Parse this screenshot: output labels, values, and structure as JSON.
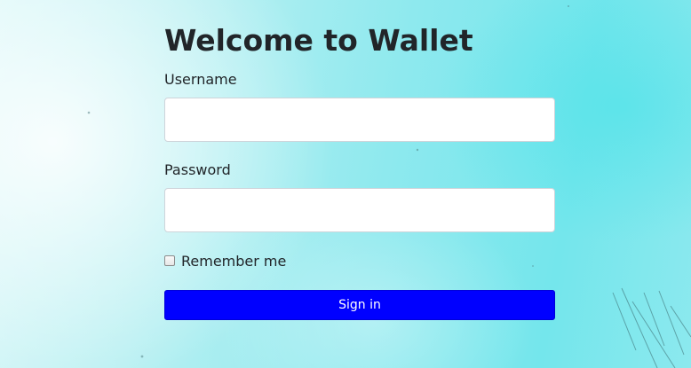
{
  "page": {
    "title": "Welcome to Wallet"
  },
  "form": {
    "username_label": "Username",
    "username_value": "",
    "password_label": "Password",
    "password_value": "",
    "remember_label": "Remember me",
    "remember_checked": false,
    "submit_label": "Sign in"
  },
  "colors": {
    "accent": "#0000ff",
    "text": "#212529",
    "background": "#8ee9ee"
  }
}
